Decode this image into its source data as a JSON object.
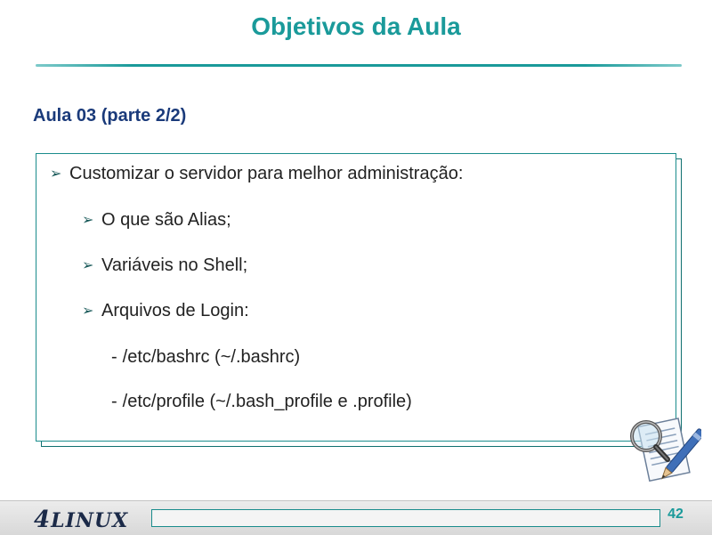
{
  "slide": {
    "title": "Objetivos da Aula",
    "subtitle": "Aula 03 (parte 2/2)"
  },
  "content": {
    "bullet_symbol": "➢",
    "main_item": "Customizar o servidor para melhor administração:",
    "sub_items": [
      "O que são Alias;",
      "Variáveis no Shell;",
      "Arquivos de Login:"
    ],
    "login_files": [
      {
        "dash": "-",
        "text": "/etc/bashrc (~/.bashrc)"
      },
      {
        "dash": "-",
        "text": "/etc/profile  (~/.bash_profile e .profile)"
      }
    ]
  },
  "footer": {
    "logo_number": "4",
    "logo_text": "LINUX",
    "page_number": "42"
  },
  "colors": {
    "title": "#1a9a9a",
    "subtitle": "#1a3a7a",
    "accent": "#1a8c8c",
    "text": "#222222"
  },
  "icons": [
    "magnifier-document-icon"
  ]
}
